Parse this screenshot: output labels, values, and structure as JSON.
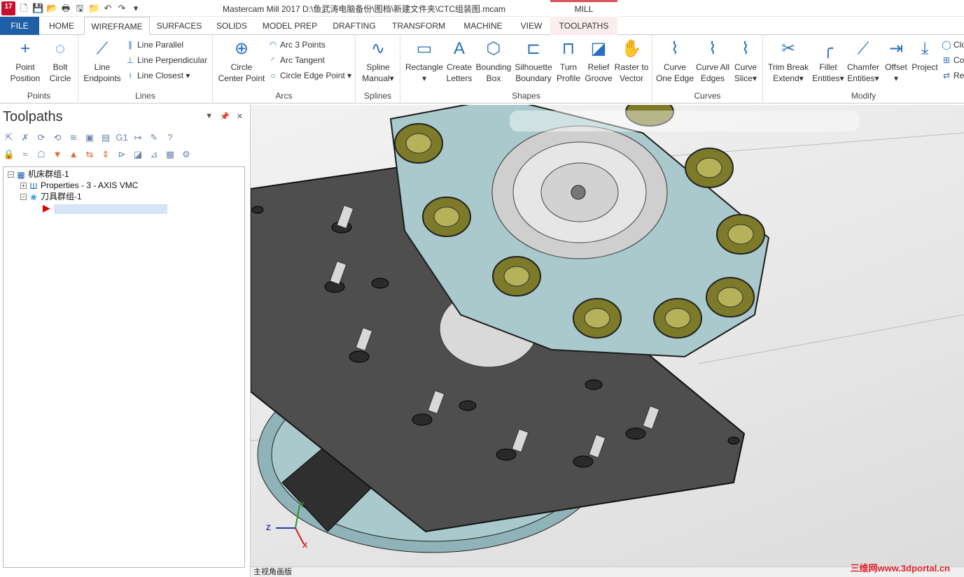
{
  "app": {
    "title": "Mastercam Mill 2017  D:\\鱼武涛电脑备份\\图档\\新建文件夹\\CTC组装图.mcam",
    "context_group": "MILL",
    "logo_text": "17"
  },
  "tabs": [
    "FILE",
    "HOME",
    "WIREFRAME",
    "SURFACES",
    "SOLIDS",
    "MODEL PREP",
    "DRAFTING",
    "TRANSFORM",
    "MACHINE",
    "VIEW",
    "TOOLPATHS"
  ],
  "ribbon": {
    "points": {
      "label": "Points",
      "buttons": [
        [
          "Point",
          "Position"
        ],
        [
          "Bolt",
          "Circle"
        ]
      ]
    },
    "lines": {
      "label": "Lines",
      "big": [
        "Line",
        "Endpoints"
      ],
      "small": [
        "Line Parallel",
        "Line Perpendicular",
        "Line Closest"
      ]
    },
    "arcs": {
      "label": "Arcs",
      "big": [
        "Circle",
        "Center Point"
      ],
      "small": [
        "Arc 3 Points",
        "Arc Tangent",
        "Circle Edge Point"
      ]
    },
    "splines": {
      "label": "Splines",
      "big": [
        "Spline",
        "Manual"
      ]
    },
    "shapes": {
      "label": "Shapes",
      "buttons": [
        [
          "Rectangle",
          ""
        ],
        [
          "Create",
          "Letters"
        ],
        [
          "Bounding",
          "Box"
        ],
        [
          "Silhouette",
          "Boundary"
        ],
        [
          "Turn",
          "Profile"
        ],
        [
          "Relief",
          "Groove"
        ],
        [
          "Raster to",
          "Vector"
        ]
      ]
    },
    "curves": {
      "label": "Curves",
      "buttons": [
        [
          "Curve",
          "One Edge"
        ],
        [
          "Curve All",
          "Edges"
        ],
        [
          "Curve",
          "Slice"
        ]
      ]
    },
    "modify": {
      "label": "Modify",
      "buttons": [
        [
          "Trim Break",
          "Extend"
        ],
        [
          "Fillet",
          "Entities"
        ],
        [
          "Chamfer",
          "Entities"
        ],
        [
          "Offset",
          ""
        ],
        [
          "Project",
          ""
        ]
      ],
      "small": [
        "Clo",
        "Co",
        "Re"
      ]
    }
  },
  "panel": {
    "title": "Toolpaths",
    "tree": [
      {
        "label": "机床群组-1",
        "level": 0,
        "icon": "machine-group-icon"
      },
      {
        "label": "Properties - 3 - AXIS VMC",
        "level": 1,
        "icon": "properties-icon"
      },
      {
        "label": "刀具群组-1",
        "level": 1,
        "icon": "toolgroup-icon"
      }
    ]
  },
  "status": {
    "view_label": "主视角画版"
  },
  "axes": {
    "x": "X",
    "y": "Y",
    "z": "Z"
  },
  "watermark": "三维网www.3dportal.cn",
  "colors": {
    "file_tab": "#1f5fa8",
    "ribbon_icon": "#2a6fbe",
    "context_accent": "#e0525a",
    "model_body": "#a9c9cc",
    "model_plate": "#505050",
    "model_collet": "#8a8a2e"
  }
}
